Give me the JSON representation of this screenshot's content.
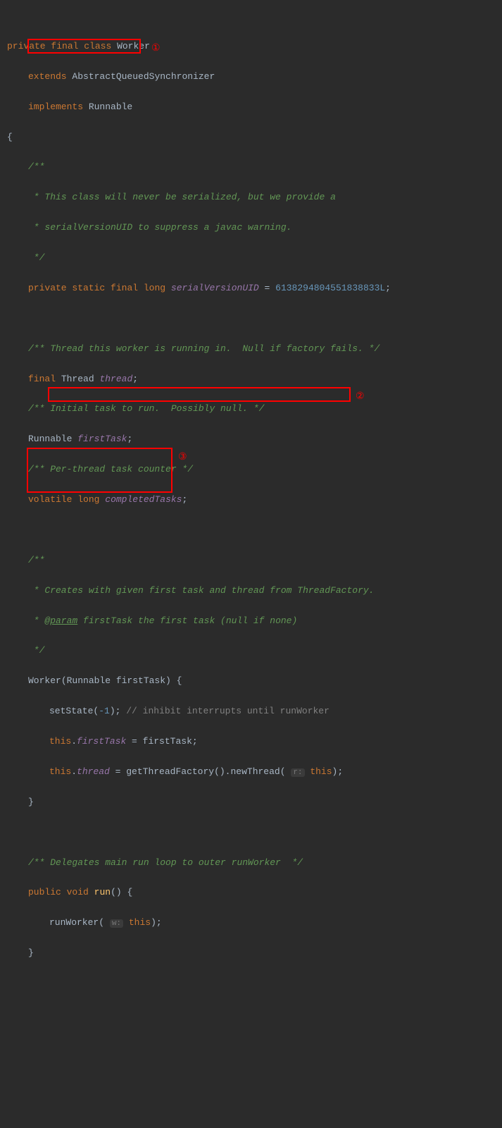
{
  "lines": {
    "l1": {
      "private": "private",
      "final": "final",
      "class": "class",
      "worker": "Worker"
    },
    "l2": {
      "extends": "extends",
      "abstractQueued": "AbstractQueuedSynchronizer"
    },
    "l3": {
      "implements": "implements",
      "runnable": "Runnable"
    },
    "l4": {
      "brace": "{"
    },
    "l5": {
      "comment": "/**"
    },
    "l6": {
      "comment": " * This class will never be serialized, but we provide a"
    },
    "l7": {
      "comment": " * serialVersionUID to suppress a javac warning."
    },
    "l8": {
      "comment": " */"
    },
    "l9": {
      "private": "private",
      "static": "static",
      "final": "final",
      "long": "long",
      "field": "serialVersionUID",
      "eq": " = ",
      "num": "6138294804551838833L",
      "semi": ";"
    },
    "l10": {
      "comment": "/** Thread this worker is running in.  Null if factory fails. */"
    },
    "l11": {
      "final": "final",
      "thread": "Thread",
      "field": "thread",
      "semi": ";"
    },
    "l12": {
      "comment": "/** Initial task to run.  Possibly null. */"
    },
    "l13": {
      "runnable": "Runnable",
      "field": "firstTask",
      "semi": ";"
    },
    "l14": {
      "comment": "/** Per-thread task counter */"
    },
    "l15": {
      "volatile": "volatile",
      "long": "long",
      "field": "completedTasks",
      "semi": ";"
    },
    "l16": {
      "comment": "/**"
    },
    "l17": {
      "comment": " * Creates with given first task and thread from ThreadFactory."
    },
    "l18": {
      "commentPre": " * ",
      "param": "@param",
      "commentPost": " firstTask the first task (null if none)"
    },
    "l19": {
      "comment": " */"
    },
    "l20": {
      "worker": "Worker",
      "paren": "(Runnable firstTask) {"
    },
    "l21": {
      "setState": "setState",
      "args": "(",
      "neg1": "-1",
      "close": "); ",
      "comment": "// inhibit interrupts until runWorker"
    },
    "l22": {
      "this": "this",
      "dot": ".",
      "field": "firstTask",
      "eq": " = firstTask;"
    },
    "l23": {
      "this": "this",
      "dot": ".",
      "field": "thread",
      "eq": " = ",
      "getTF": "getThreadFactory",
      "paren1": "().",
      "newThread": "newThread",
      "paren2": "( ",
      "hint": "r:",
      "sp": " ",
      "thisArg": "this",
      "close": ");"
    },
    "l24": {
      "brace": "}"
    },
    "l25": {
      "comment": "/** Delegates main run loop to outer runWorker  */"
    },
    "l26": {
      "public": "public",
      "void": "void",
      "run": "run",
      "paren": "() {"
    },
    "l27": {
      "runWorker": "runWorker",
      "paren": "( ",
      "hint": "w:",
      "sp": " ",
      "this": "this",
      "close": ");"
    },
    "l28": {
      "brace": "}"
    }
  },
  "annotations": {
    "a1": "①",
    "a2": "②",
    "a3": "③"
  }
}
